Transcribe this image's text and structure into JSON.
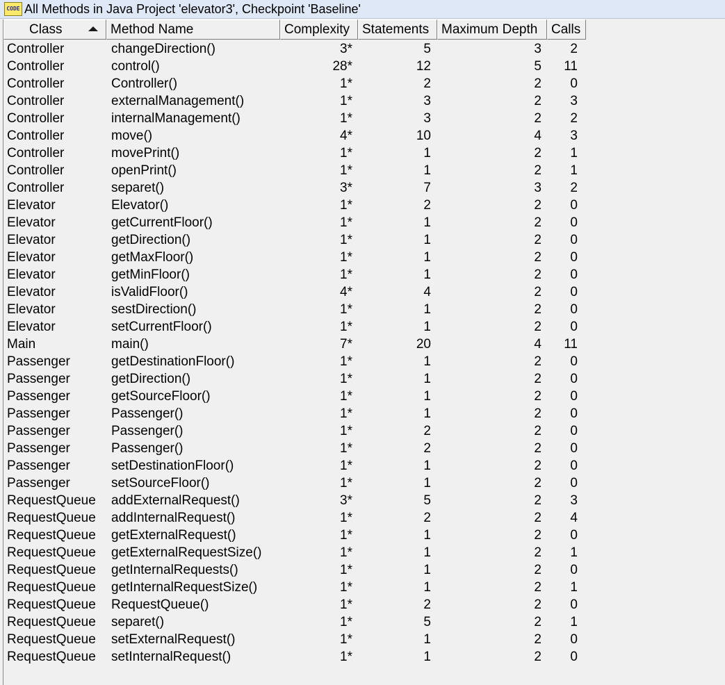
{
  "window": {
    "title": "All Methods in Java Project 'elevator3', Checkpoint 'Baseline'",
    "icon": "code-icon",
    "icon_text": "CODE"
  },
  "table": {
    "sort_column": "Class",
    "sort_direction": "ascending",
    "columns": [
      "Class",
      "Method Name",
      "Complexity",
      "Statements",
      "Maximum Depth",
      "Calls"
    ],
    "rows": [
      [
        "Controller",
        "changeDirection()",
        "3*",
        "5",
        "3",
        "2"
      ],
      [
        "Controller",
        "control()",
        "28*",
        "12",
        "5",
        "11"
      ],
      [
        "Controller",
        "Controller()",
        "1*",
        "2",
        "2",
        "0"
      ],
      [
        "Controller",
        "externalManagement()",
        "1*",
        "3",
        "2",
        "3"
      ],
      [
        "Controller",
        "internalManagement()",
        "1*",
        "3",
        "2",
        "2"
      ],
      [
        "Controller",
        "move()",
        "4*",
        "10",
        "4",
        "3"
      ],
      [
        "Controller",
        "movePrint()",
        "1*",
        "1",
        "2",
        "1"
      ],
      [
        "Controller",
        "openPrint()",
        "1*",
        "1",
        "2",
        "1"
      ],
      [
        "Controller",
        "separet()",
        "3*",
        "7",
        "3",
        "2"
      ],
      [
        "Elevator",
        "Elevator()",
        "1*",
        "2",
        "2",
        "0"
      ],
      [
        "Elevator",
        "getCurrentFloor()",
        "1*",
        "1",
        "2",
        "0"
      ],
      [
        "Elevator",
        "getDirection()",
        "1*",
        "1",
        "2",
        "0"
      ],
      [
        "Elevator",
        "getMaxFloor()",
        "1*",
        "1",
        "2",
        "0"
      ],
      [
        "Elevator",
        "getMinFloor()",
        "1*",
        "1",
        "2",
        "0"
      ],
      [
        "Elevator",
        "isValidFloor()",
        "4*",
        "4",
        "2",
        "0"
      ],
      [
        "Elevator",
        "sestDirection()",
        "1*",
        "1",
        "2",
        "0"
      ],
      [
        "Elevator",
        "setCurrentFloor()",
        "1*",
        "1",
        "2",
        "0"
      ],
      [
        "Main",
        "main()",
        "7*",
        "20",
        "4",
        "11"
      ],
      [
        "Passenger",
        "getDestinationFloor()",
        "1*",
        "1",
        "2",
        "0"
      ],
      [
        "Passenger",
        "getDirection()",
        "1*",
        "1",
        "2",
        "0"
      ],
      [
        "Passenger",
        "getSourceFloor()",
        "1*",
        "1",
        "2",
        "0"
      ],
      [
        "Passenger",
        "Passenger()",
        "1*",
        "1",
        "2",
        "0"
      ],
      [
        "Passenger",
        "Passenger()",
        "1*",
        "2",
        "2",
        "0"
      ],
      [
        "Passenger",
        "Passenger()",
        "1*",
        "2",
        "2",
        "0"
      ],
      [
        "Passenger",
        "setDestinationFloor()",
        "1*",
        "1",
        "2",
        "0"
      ],
      [
        "Passenger",
        "setSourceFloor()",
        "1*",
        "1",
        "2",
        "0"
      ],
      [
        "RequestQueue",
        "addExternalRequest()",
        "3*",
        "5",
        "2",
        "3"
      ],
      [
        "RequestQueue",
        "addInternalRequest()",
        "1*",
        "2",
        "2",
        "4"
      ],
      [
        "RequestQueue",
        "getExternalRequest()",
        "1*",
        "1",
        "2",
        "0"
      ],
      [
        "RequestQueue",
        "getExternalRequestSize()",
        "1*",
        "1",
        "2",
        "1"
      ],
      [
        "RequestQueue",
        "getInternalRequests()",
        "1*",
        "1",
        "2",
        "0"
      ],
      [
        "RequestQueue",
        "getInternalRequestSize()",
        "1*",
        "1",
        "2",
        "1"
      ],
      [
        "RequestQueue",
        "RequestQueue()",
        "1*",
        "2",
        "2",
        "0"
      ],
      [
        "RequestQueue",
        "separet()",
        "1*",
        "5",
        "2",
        "1"
      ],
      [
        "RequestQueue",
        "setExternalRequest()",
        "1*",
        "1",
        "2",
        "0"
      ],
      [
        "RequestQueue",
        "setInternalRequest()",
        "1*",
        "1",
        "2",
        "0"
      ]
    ]
  }
}
